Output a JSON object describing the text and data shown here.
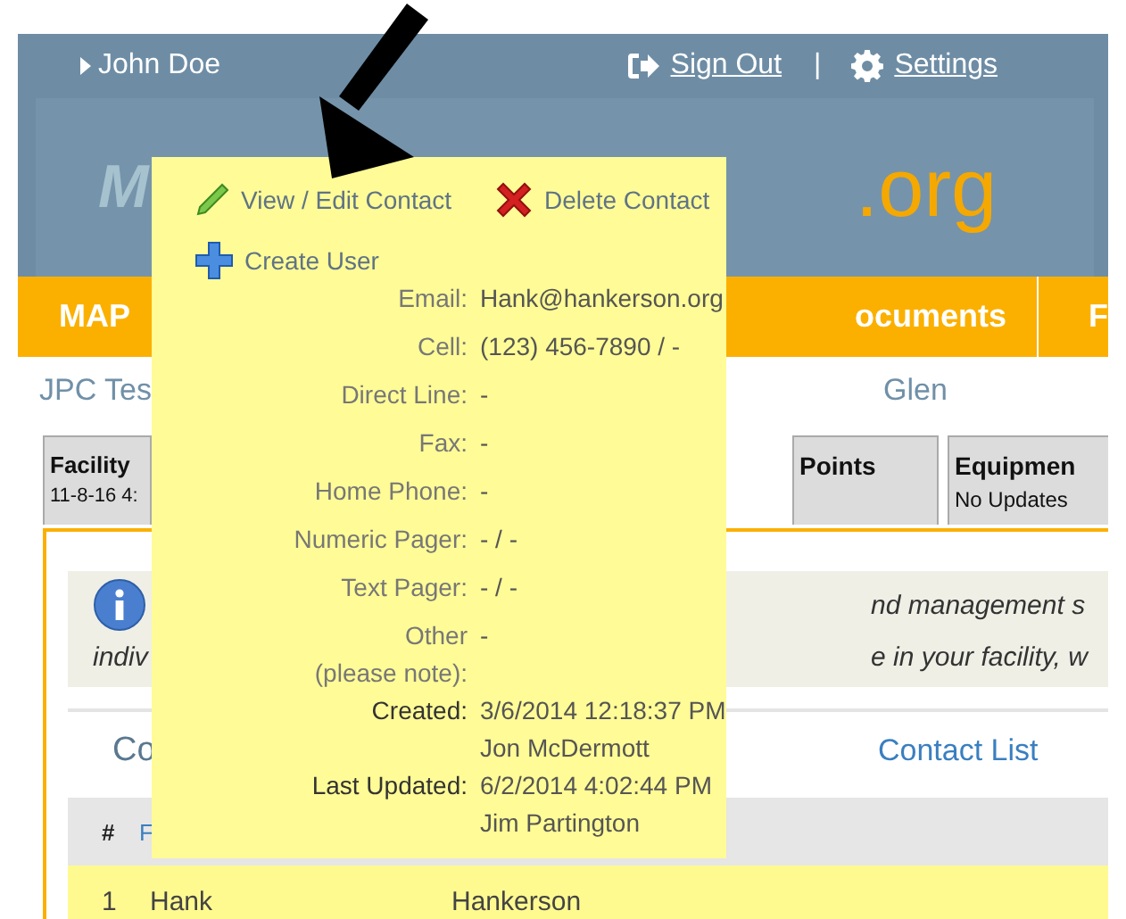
{
  "header": {
    "user": "John Doe",
    "sign_out": "Sign Out",
    "separator": "|",
    "settings": "Settings",
    "logo_left": "M",
    "logo_right": ".org"
  },
  "nav": {
    "items": [
      "MAP",
      "ocuments",
      "F"
    ]
  },
  "breadcrumb": [
    "JPC Tes",
    "Glen"
  ],
  "tabs": [
    {
      "title": "Facility",
      "subtitle": "11-8-16 4:"
    },
    {
      "title": "Points"
    },
    {
      "title": "Equipmen",
      "subtitle": "No Updates"
    }
  ],
  "info": {
    "line_1_right": "nd management s",
    "line_2_left": "indiv",
    "line_2_right": "e in your facility, w"
  },
  "section": {
    "title": "Co",
    "link": "Contact List"
  },
  "table": {
    "columns": [
      "#",
      "F"
    ],
    "rows": [
      [
        "1",
        "Hank",
        "Hankerson"
      ]
    ]
  },
  "popup": {
    "actions": [
      {
        "kind": "edit",
        "label": "View / Edit Contact"
      },
      {
        "kind": "delete",
        "label": "Delete Contact"
      },
      {
        "kind": "create",
        "label": "Create User"
      }
    ],
    "fields": [
      {
        "label": "Email:",
        "values": [
          "Hank@hankerson.org"
        ],
        "strong": false
      },
      {
        "label": "Cell:",
        "values": [
          "(123) 456-7890 / -"
        ],
        "strong": false
      },
      {
        "label": "Direct Line:",
        "values": [
          "-"
        ],
        "strong": false
      },
      {
        "label": "Fax:",
        "values": [
          "-"
        ],
        "strong": false
      },
      {
        "label": "Home Phone:",
        "values": [
          "-"
        ],
        "strong": false
      },
      {
        "label": "Numeric Pager:",
        "values": [
          "- / -"
        ],
        "strong": false
      },
      {
        "label": "Text Pager:",
        "values": [
          "- / -"
        ],
        "strong": false
      },
      {
        "label": "Other\n(please note):",
        "values": [
          "-"
        ],
        "strong": false
      },
      {
        "label": "Created:",
        "values": [
          "3/6/2014 12:18:37 PM",
          "Jon McDermott"
        ],
        "strong": true
      },
      {
        "label": "Last Updated:",
        "values": [
          "6/2/2014 4:02:44 PM",
          "Jim Partington"
        ],
        "strong": true
      }
    ]
  }
}
